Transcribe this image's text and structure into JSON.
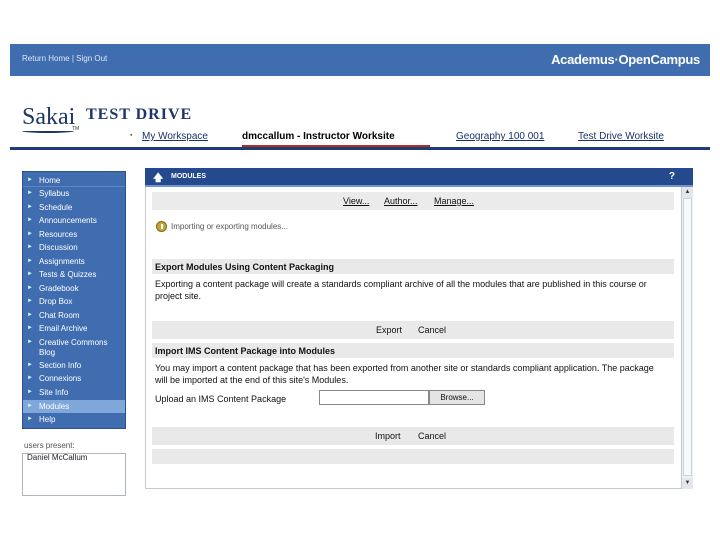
{
  "topbar": {
    "return_home": "Return Home",
    "separator": "|",
    "sign_out": "Sign Out",
    "brand": "Academus·OpenCampus"
  },
  "header": {
    "logo": "Sakai",
    "tm": "TM",
    "site_title": "TEST DRIVE",
    "tabs": [
      {
        "label": "My Workspace"
      },
      {
        "label": "dmccallum - Instructor Worksite"
      },
      {
        "label": "Geography 100 001"
      },
      {
        "label": "Test Drive Worksite"
      }
    ]
  },
  "sidebar": {
    "items": [
      {
        "label": "Home"
      },
      {
        "label": "Syllabus"
      },
      {
        "label": "Schedule"
      },
      {
        "label": "Announcements"
      },
      {
        "label": "Resources"
      },
      {
        "label": "Discussion"
      },
      {
        "label": "Assignments"
      },
      {
        "label": "Tests & Quizzes"
      },
      {
        "label": "Gradebook"
      },
      {
        "label": "Drop Box"
      },
      {
        "label": "Chat Room"
      },
      {
        "label": "Email Archive"
      },
      {
        "label": "Creative Commons"
      },
      {
        "label": "Blog"
      },
      {
        "label": "Section Info"
      },
      {
        "label": "Connexions"
      },
      {
        "label": "Site Info"
      },
      {
        "label": "Modules"
      },
      {
        "label": "Help"
      }
    ],
    "users_present_label": "users present:",
    "users": [
      "Daniel McCallum"
    ]
  },
  "main": {
    "title": "MODULES",
    "help": "?",
    "menu": [
      "View...",
      "Author...",
      "Manage..."
    ],
    "info": "Importing or exporting modules...",
    "export_section": {
      "heading": "Export Modules Using Content Packaging",
      "text": "Exporting a content package will create a standards compliant archive of all the modules that are published in this course or project site.",
      "export_button": "Export",
      "cancel_button": "Cancel"
    },
    "import_section": {
      "heading": "Import IMS Content Package into Modules",
      "text": "You may import a content package that has been exported from another site or standards compliant application. The package will be imported at the end of this site's Modules.",
      "upload_label": "Upload an IMS Content Package",
      "upload_value": "",
      "browse_button": "Browse...",
      "import_button": "Import",
      "cancel_button": "Cancel"
    }
  },
  "colors": {
    "brand_blue": "#3f6db0",
    "dark_blue": "#244a8d",
    "active_tab_red": "#b22d1b",
    "active_nav": "#7fa7da"
  }
}
